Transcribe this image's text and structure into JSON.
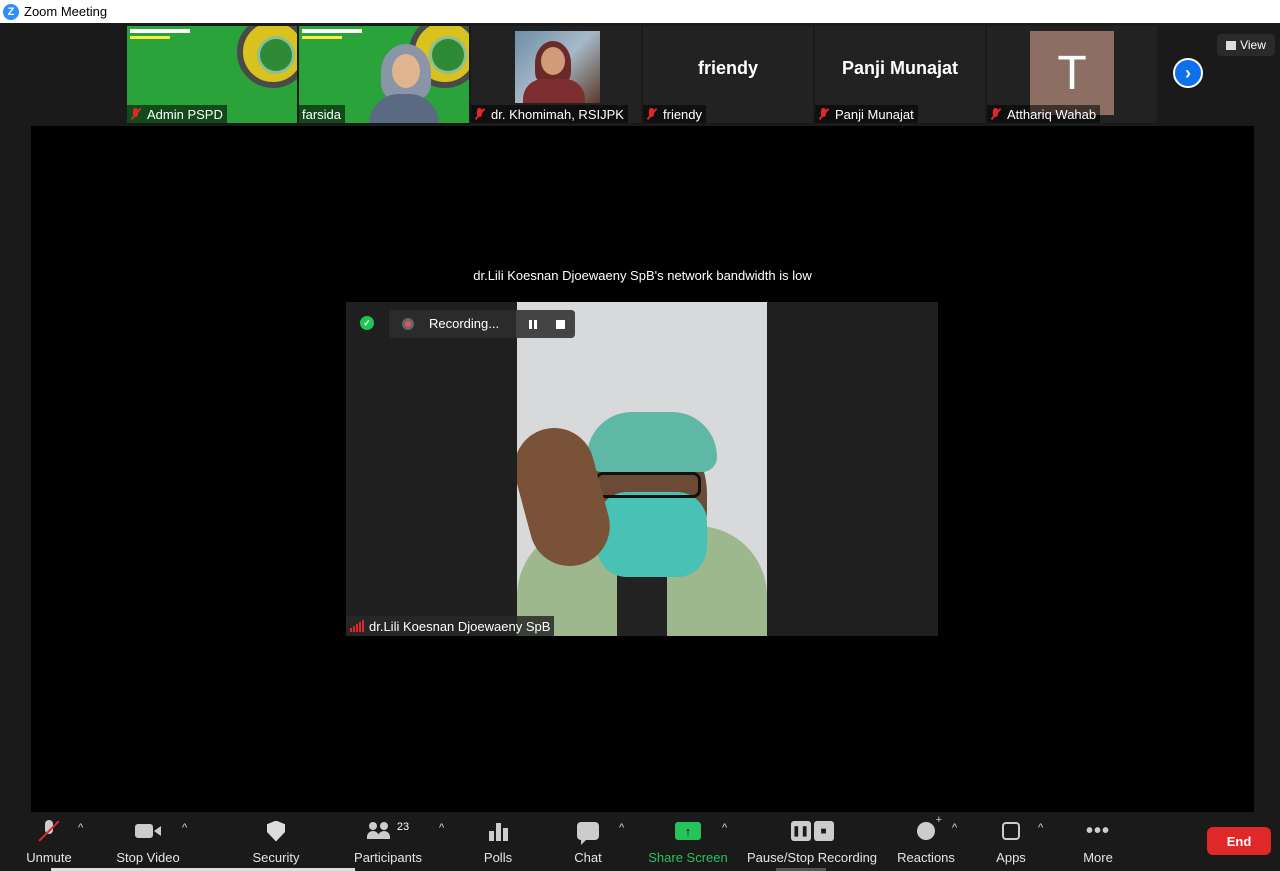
{
  "window": {
    "title": "Zoom Meeting"
  },
  "strip": {
    "view_label": "View",
    "tiles": [
      {
        "name": "Admin PSPD",
        "muted": true
      },
      {
        "name": "farsida",
        "muted": false
      },
      {
        "name": "dr. Khomimah, RSIJPK",
        "muted": true
      },
      {
        "name": "friendy",
        "muted": true,
        "display_text": "friendy"
      },
      {
        "name": "Panji Munajat",
        "muted": true,
        "display_text": "Panji Munajat"
      },
      {
        "name": "Atthariq Wahab",
        "muted": true,
        "avatar_letter": "T"
      }
    ]
  },
  "stage": {
    "bandwidth_notice": "dr.Lili Koesnan Djoewaeny SpB's network bandwidth is low",
    "recording_label": "Recording...",
    "speaker_name": "dr.Lili Koesnan Djoewaeny SpB"
  },
  "toolbar": {
    "unmute": "Unmute",
    "stop_video": "Stop Video",
    "security": "Security",
    "participants": "Participants",
    "participants_count": "23",
    "polls": "Polls",
    "chat": "Chat",
    "share_screen": "Share Screen",
    "pause_stop_recording": "Pause/Stop Recording",
    "reactions": "Reactions",
    "apps": "Apps",
    "more": "More",
    "end": "End"
  },
  "colors": {
    "accent_blue": "#0e71eb",
    "share_green": "#25c35a",
    "end_red": "#e02828",
    "muted_red": "#e02828"
  }
}
